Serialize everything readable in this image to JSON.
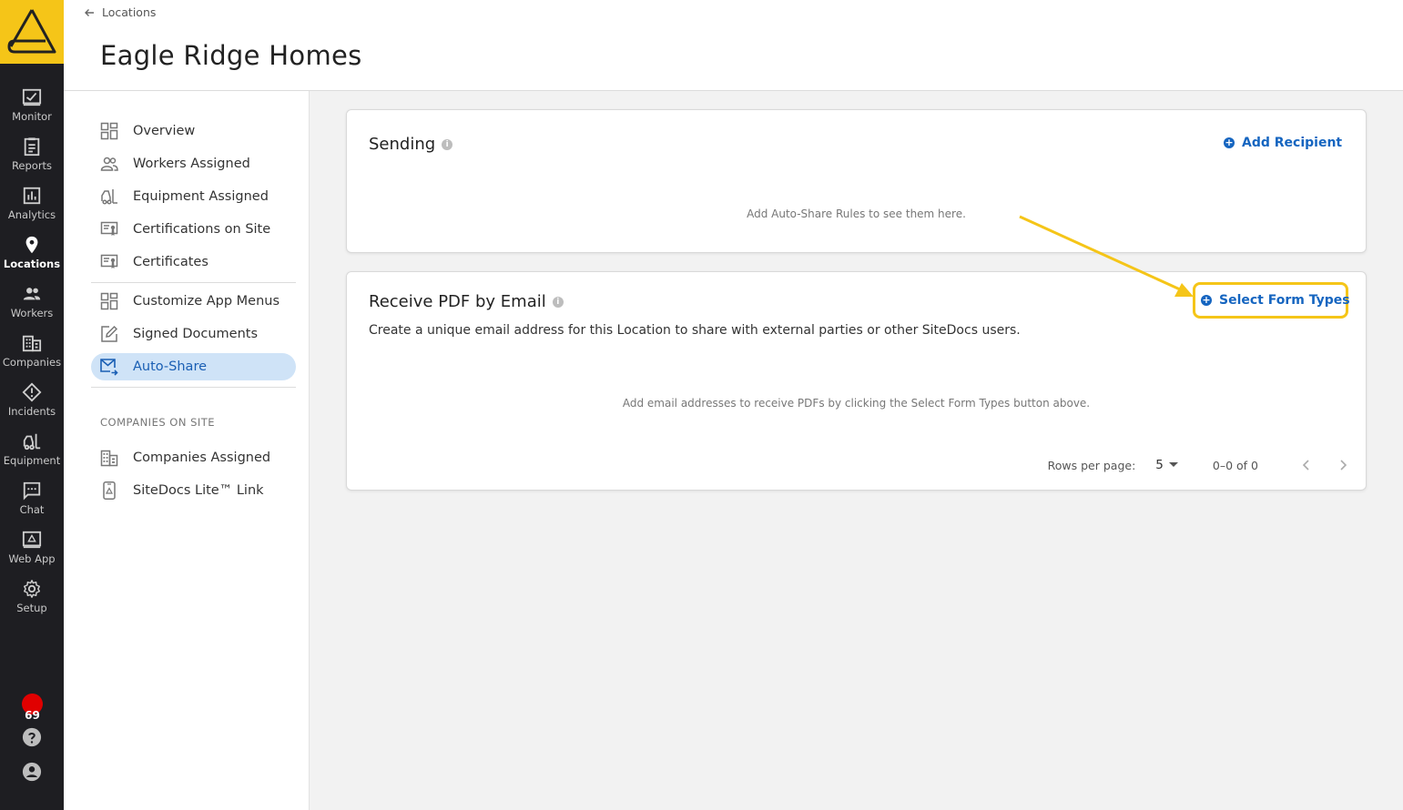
{
  "rail": {
    "items": [
      {
        "label": "Monitor",
        "icon": "monitor-icon"
      },
      {
        "label": "Reports",
        "icon": "reports-icon"
      },
      {
        "label": "Analytics",
        "icon": "analytics-icon"
      },
      {
        "label": "Locations",
        "icon": "location-pin-icon"
      },
      {
        "label": "Workers",
        "icon": "workers-icon"
      },
      {
        "label": "Companies",
        "icon": "companies-icon"
      },
      {
        "label": "Incidents",
        "icon": "incident-icon"
      },
      {
        "label": "Equipment",
        "icon": "forklift-icon"
      },
      {
        "label": "Chat",
        "icon": "chat-icon"
      },
      {
        "label": "Web App",
        "icon": "web-app-icon"
      },
      {
        "label": "Setup",
        "icon": "gear-icon"
      }
    ],
    "active": "Locations",
    "notification_count": "69"
  },
  "header": {
    "breadcrumb": "Locations",
    "title": "Eagle Ridge Homes"
  },
  "subnav": {
    "items": [
      {
        "label": "Overview"
      },
      {
        "label": "Workers Assigned"
      },
      {
        "label": "Equipment Assigned"
      },
      {
        "label": "Certifications on Site"
      },
      {
        "label": "Certificates"
      },
      {
        "label": "Customize App Menus"
      },
      {
        "label": "Signed Documents"
      },
      {
        "label": "Auto-Share"
      }
    ],
    "active": "Auto-Share",
    "section_label": "COMPANIES ON SITE",
    "section_items": [
      {
        "label": "Companies Assigned"
      },
      {
        "label": "SiteDocs Lite™ Link"
      }
    ]
  },
  "sending": {
    "title": "Sending",
    "add_button": "Add Recipient",
    "empty": "Add Auto-Share Rules to see them here."
  },
  "receive_pdf": {
    "title": "Receive PDF by Email",
    "description": "Create a unique email address for this Location to share with external parties or other SiteDocs users.",
    "select_button": "Select Form Types",
    "empty": "Add email addresses to receive PDFs by clicking the Select Form Types button above.",
    "pager": {
      "rows_label": "Rows per page:",
      "rows_value": "5",
      "range": "0–0 of 0"
    }
  },
  "colors": {
    "accent": "#f5c518",
    "link": "#1565c0",
    "rail_bg": "#1e1e22",
    "active_nav_bg": "#cfe3f7"
  }
}
